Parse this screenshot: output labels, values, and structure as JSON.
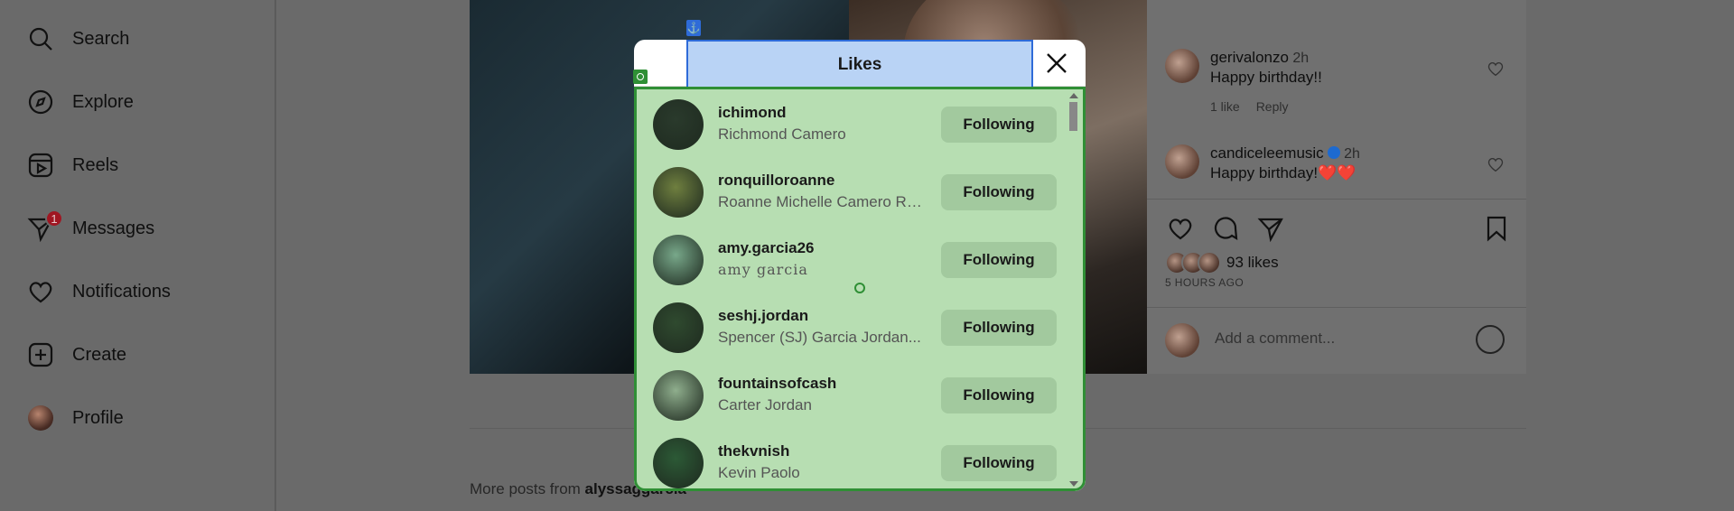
{
  "sidebar": {
    "items": [
      {
        "label": "Search",
        "icon": "search-icon"
      },
      {
        "label": "Explore",
        "icon": "compass-icon"
      },
      {
        "label": "Reels",
        "icon": "reels-icon"
      },
      {
        "label": "Messages",
        "icon": "messages-icon",
        "badge": "1"
      },
      {
        "label": "Notifications",
        "icon": "heart-icon"
      },
      {
        "label": "Create",
        "icon": "plus-square-icon"
      },
      {
        "label": "Profile",
        "icon": "avatar"
      }
    ]
  },
  "post": {
    "comments": [
      {
        "user": "gerivalonzo",
        "time": "2h",
        "text": "Happy birthday!!",
        "likes": "1 like",
        "reply": "Reply"
      },
      {
        "user": "candiceleemusic",
        "time": "2h",
        "text": "Happy birthday!",
        "hearts": "❤️❤️"
      }
    ],
    "likes": "93 likes",
    "time_ago": "5 HOURS AGO",
    "comment_placeholder": "Add a comment..."
  },
  "more_posts": {
    "prefix": "More posts from ",
    "user": "alyssaggarcia"
  },
  "modal": {
    "title": "Likes",
    "users": [
      {
        "username": "ichimond",
        "full_name": "Richmond Camero",
        "button": "Following",
        "avatar_color": "#2a3a2c"
      },
      {
        "username": "ronquilloroanne",
        "full_name": "Roanne Michelle Camero Ro...",
        "button": "Following",
        "avatar_color": "#6f7f3f"
      },
      {
        "username": "amy.garcia26",
        "full_name": "amy garcia",
        "button": "Following",
        "avatar_color": "#78a88a"
      },
      {
        "username": "seshj.jordan",
        "full_name": "Spencer (SJ) Garcia Jordan...",
        "button": "Following",
        "avatar_color": "#2f4a2f"
      },
      {
        "username": "fountainsofcash",
        "full_name": "Carter Jordan",
        "button": "Following",
        "avatar_color": "#8fae8d"
      },
      {
        "username": "thekvnish",
        "full_name": "Kevin Paolo",
        "button": "Following",
        "avatar_color": "#2c5a36"
      }
    ]
  }
}
